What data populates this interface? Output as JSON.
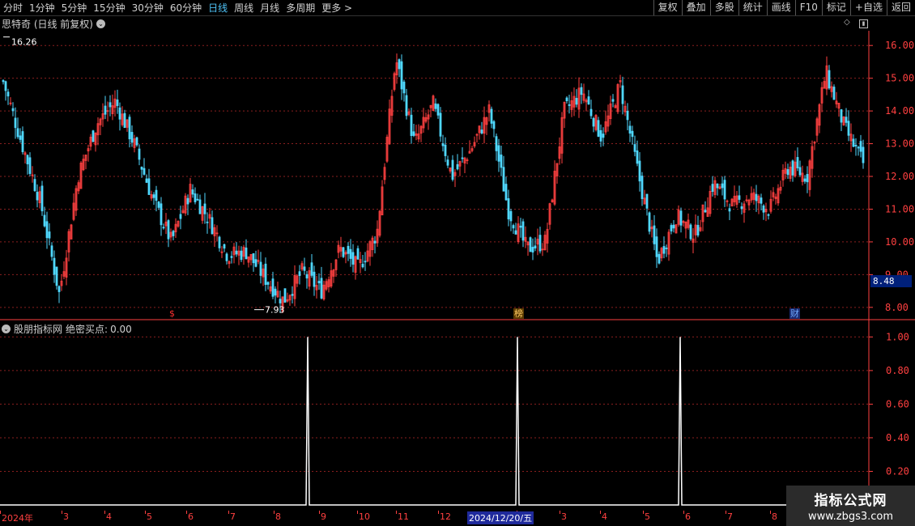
{
  "toolbar": {
    "periods": [
      "分时",
      "1分钟",
      "5分钟",
      "15分钟",
      "30分钟",
      "60分钟",
      "日线",
      "周线",
      "月线",
      "多周期",
      "更多 >"
    ],
    "active_period": "日线",
    "actions": [
      "复权",
      "叠加",
      "多股",
      "统计",
      "画线",
      "F10",
      "标记",
      "+自选",
      "返回"
    ]
  },
  "main_panel": {
    "title": "思特奇 (日线 前复权)",
    "high_label": "16.26",
    "low_label": "7.93",
    "current_price_label": "8.48",
    "event_tags": [
      {
        "text": "$",
        "color": "#ff3030"
      },
      {
        "text": "榜",
        "color": "#ffcc66"
      },
      {
        "text": "财",
        "color": "#6fa8ff"
      }
    ]
  },
  "indicator_panel": {
    "title": "股朋指标网",
    "indicator_name": "绝密买点:",
    "indicator_value": "0.00"
  },
  "date_axis": {
    "labels": [
      "2024年",
      "3",
      "4",
      "5",
      "6",
      "7",
      "8",
      "9",
      "10",
      "11",
      "12",
      "1",
      "2",
      "3",
      "4",
      "5",
      "6",
      "7",
      "8"
    ],
    "cursor_label": "2024/12/20/五"
  },
  "watermark": {
    "title": "指标公式网",
    "url": "www.zbgs3.com"
  },
  "colors": {
    "up": "#ff4040",
    "down": "#4fd8ff",
    "grid": "#8a1f1f",
    "axis_text": "#ff4040",
    "signal": "#ffffff"
  },
  "chart_data": [
    {
      "type": "candlestick",
      "title": "思特奇 (日线 前复权)",
      "xlabel": "",
      "ylabel": "",
      "y_ticks": [
        8.0,
        9.0,
        10.0,
        11.0,
        12.0,
        13.0,
        14.0,
        15.0,
        16.0
      ],
      "ylim": [
        7.6,
        16.45
      ],
      "x_period": [
        "2024-02",
        "2025-08"
      ],
      "grid": true,
      "annotations": [
        {
          "text": "16.26",
          "value": 16.26,
          "kind": "period_high"
        },
        {
          "text": "7.93",
          "value": 7.93,
          "kind": "period_low"
        },
        {
          "text": "8.48",
          "value": 8.48,
          "kind": "current_price"
        }
      ],
      "close_path": [
        [
          "2024-02",
          14.9
        ],
        [
          "2024-02",
          13.0
        ],
        [
          "2024-02",
          11.2
        ],
        [
          "2024-02",
          8.4
        ],
        [
          "2024-03",
          12.0
        ],
        [
          "2024-03",
          13.6
        ],
        [
          "2024-03",
          14.3
        ],
        [
          "2024-04",
          13.0
        ],
        [
          "2024-04",
          11.3
        ],
        [
          "2024-04",
          10.0
        ],
        [
          "2024-05",
          11.6
        ],
        [
          "2024-05",
          10.7
        ],
        [
          "2024-06",
          9.6
        ],
        [
          "2024-06",
          9.7
        ],
        [
          "2024-07",
          8.9
        ],
        [
          "2024-07",
          8.2
        ],
        [
          "2024-08",
          9.1
        ],
        [
          "2024-08",
          8.5
        ],
        [
          "2024-09",
          9.8
        ],
        [
          "2024-09",
          9.2
        ],
        [
          "2024-09",
          10.3
        ],
        [
          "2024-10",
          15.6
        ],
        [
          "2024-10",
          13.0
        ],
        [
          "2024-11",
          14.2
        ],
        [
          "2024-11",
          12.0
        ],
        [
          "2024-12",
          12.8
        ],
        [
          "2024-12",
          14.0
        ],
        [
          "2024-12",
          11.0
        ],
        [
          "2024-12",
          9.8
        ],
        [
          "2025-01",
          10.0
        ],
        [
          "2025-01",
          14.0
        ],
        [
          "2025-02",
          14.6
        ],
        [
          "2025-02",
          13.2
        ],
        [
          "2025-03",
          14.8
        ],
        [
          "2025-03",
          12.0
        ],
        [
          "2025-04",
          9.4
        ],
        [
          "2025-04",
          10.8
        ],
        [
          "2025-05",
          10.2
        ],
        [
          "2025-05",
          11.8
        ],
        [
          "2025-06",
          11.1
        ],
        [
          "2025-06",
          11.4
        ],
        [
          "2025-07",
          11.0
        ],
        [
          "2025-07",
          12.3
        ],
        [
          "2025-08",
          12.0
        ],
        [
          "2025-08",
          15.2
        ],
        [
          "2025-08",
          13.5
        ],
        [
          "2025-08",
          12.4
        ]
      ]
    },
    {
      "type": "line",
      "title": "绝密买点",
      "y_ticks": [
        0.2,
        0.4,
        0.6,
        0.8,
        1.0
      ],
      "ylim": [
        0,
        1.05
      ],
      "grid": true,
      "series": [
        {
          "values": [
            0,
            1,
            0,
            0,
            1,
            0,
            0,
            1,
            0
          ]
        }
      ],
      "x": [
        "",
        "2024-09",
        "",
        "",
        "2024-12-20",
        "",
        "",
        "2025-06",
        ""
      ],
      "signal_dates": [
        "2024-09",
        "2024-12-20",
        "2025-06"
      ]
    }
  ]
}
